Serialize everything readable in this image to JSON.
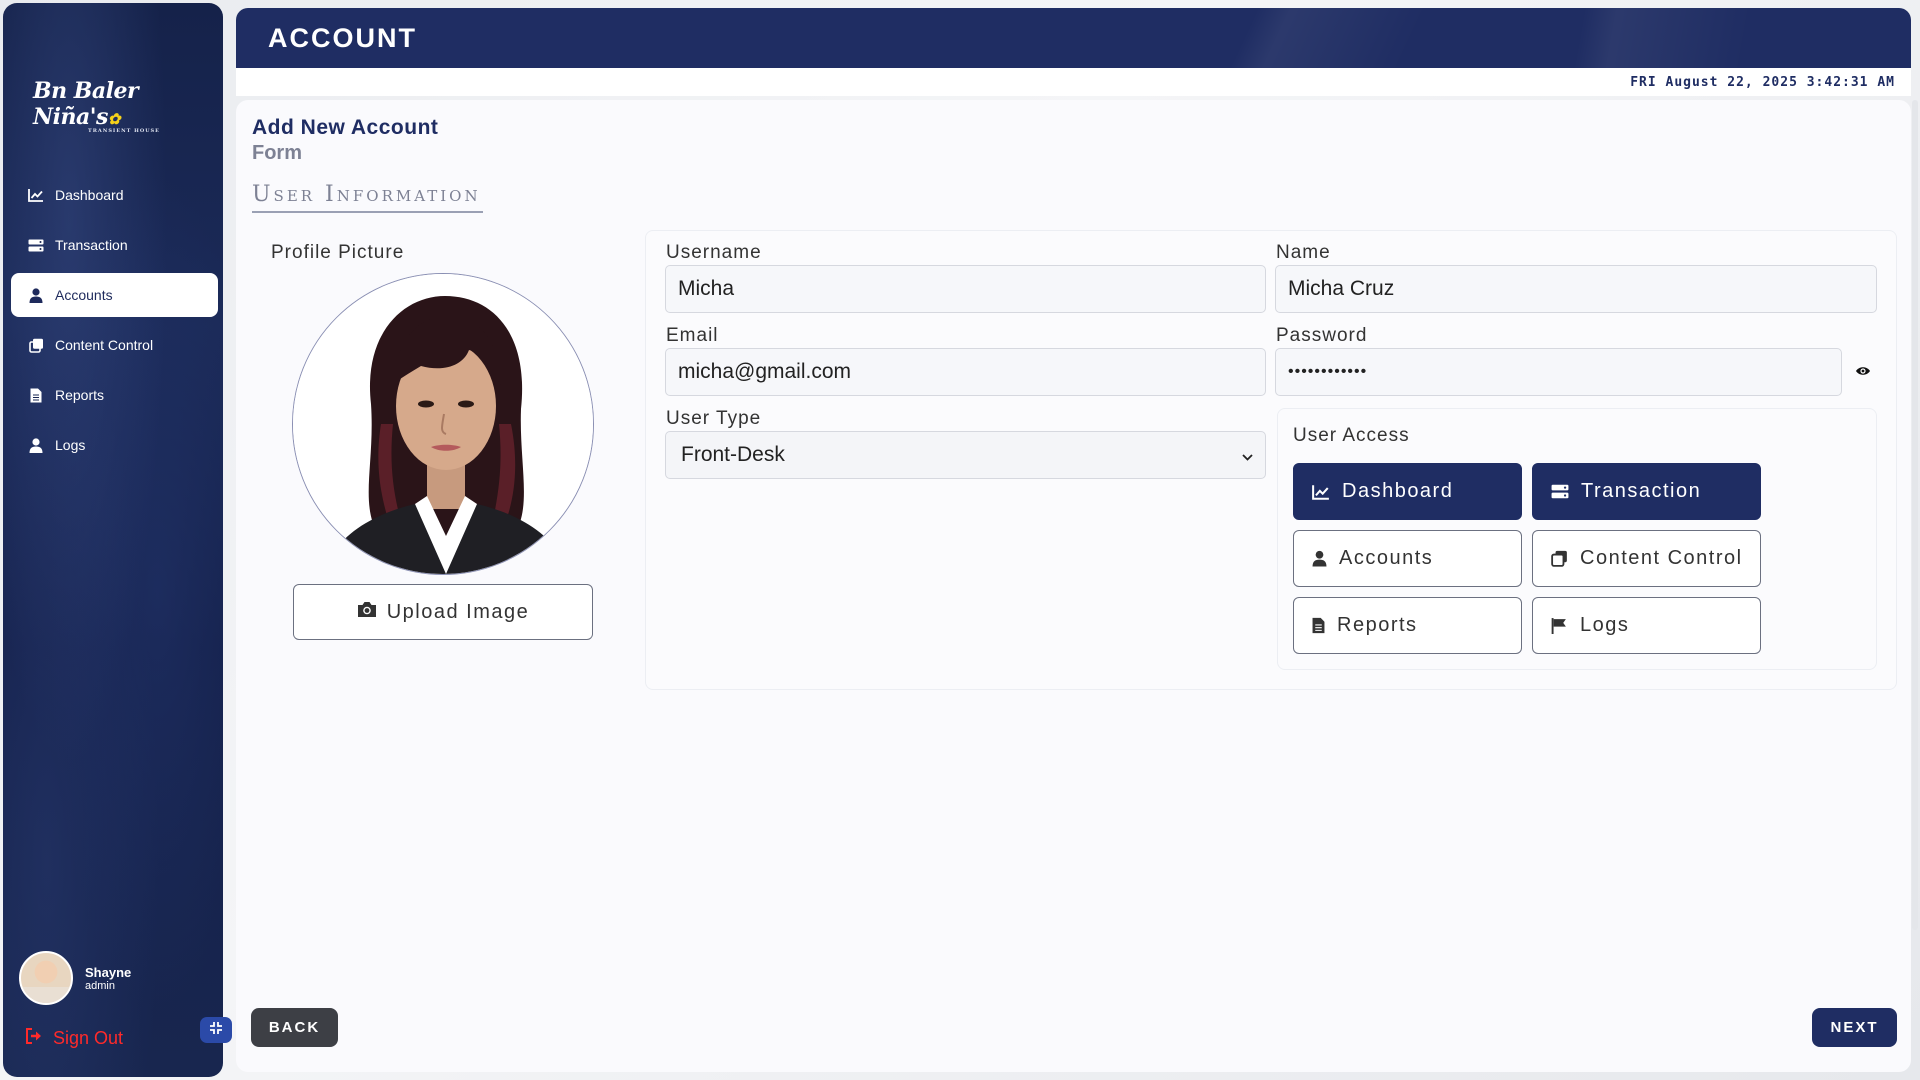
{
  "sidebar": {
    "logo_text": "Bn Baler Niña's",
    "logo_sub": "TRANSIENT HOUSE",
    "items": [
      {
        "label": "Dashboard",
        "icon": "chart-line-icon",
        "active": false
      },
      {
        "label": "Transaction",
        "icon": "server-icon",
        "active": false
      },
      {
        "label": "Accounts",
        "icon": "user-icon",
        "active": true
      },
      {
        "label": "Content Control",
        "icon": "clone-icon",
        "active": false
      },
      {
        "label": "Reports",
        "icon": "file-icon",
        "active": false
      },
      {
        "label": "Logs",
        "icon": "user-icon",
        "active": false
      }
    ],
    "user": {
      "name": "Shayne",
      "role": "admin"
    },
    "signout_label": "Sign Out"
  },
  "header": {
    "title": "ACCOUNT",
    "datetime": "FRI August 22, 2025 3:42:31 AM"
  },
  "form": {
    "title": "Add New Account",
    "subtitle": "Form",
    "section_title": "User Information",
    "profile_picture_label": "Profile Picture",
    "upload_label": "Upload Image",
    "username_label": "Username",
    "username_value": "Micha",
    "name_label": "Name",
    "name_value": "Micha Cruz",
    "email_label": "Email",
    "email_value": "micha@gmail.com",
    "password_label": "Password",
    "password_value": "••••••••••••",
    "user_type_label": "User Type",
    "user_type_value": "Front-Desk",
    "user_access_label": "User Access",
    "access": [
      {
        "label": "Dashboard",
        "icon": "chart-line-icon",
        "selected": true
      },
      {
        "label": "Transaction",
        "icon": "server-icon",
        "selected": true
      },
      {
        "label": "Accounts",
        "icon": "user-icon",
        "selected": false
      },
      {
        "label": "Content Control",
        "icon": "clone-icon",
        "selected": false
      },
      {
        "label": "Reports",
        "icon": "file-icon",
        "selected": false
      },
      {
        "label": "Logs",
        "icon": "flag-icon",
        "selected": false
      }
    ],
    "back_label": "BACK",
    "next_label": "NEXT"
  },
  "colors": {
    "primary": "#1f2d63",
    "sidebar_bg": "#17244f",
    "signout": "#ff2a2a",
    "muted_text": "#7d8194",
    "collapse_button": "#2b4aa8"
  }
}
